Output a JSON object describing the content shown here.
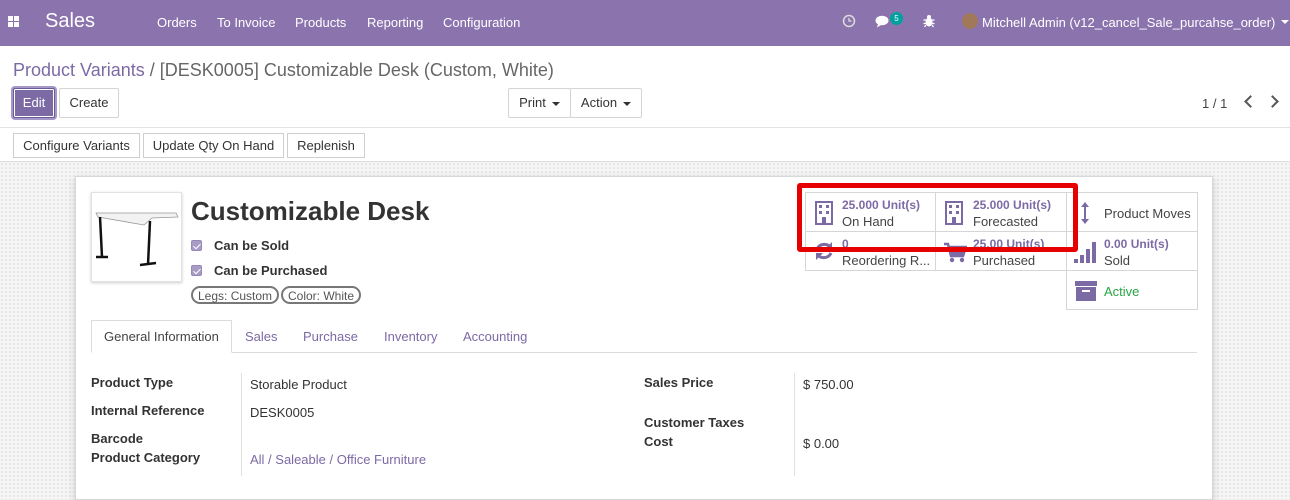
{
  "navbar": {
    "app_name": "Sales",
    "menu": [
      "Orders",
      "To Invoice",
      "Products",
      "Reporting",
      "Configuration"
    ],
    "messages_badge": "5",
    "user": "Mitchell Admin (v12_cancel_Sale_purcahse_order)",
    "bg_color": "#8b73ae"
  },
  "breadcrumb": {
    "parent": "Product Variants",
    "separator": "/",
    "current": "[DESK0005] Customizable Desk (Custom, White)"
  },
  "buttons": {
    "edit": "Edit",
    "create": "Create",
    "print": "Print",
    "action": "Action"
  },
  "pager": {
    "value": "1 / 1"
  },
  "statusbar": {
    "configure_variants": "Configure Variants",
    "update_qty": "Update Qty On Hand",
    "replenish": "Replenish"
  },
  "product": {
    "name": "Customizable Desk",
    "can_be_sold": "Can be Sold",
    "can_be_purchased": "Can be Purchased",
    "tags": [
      "Legs: Custom",
      "Color: White"
    ]
  },
  "smart_buttons": {
    "on_hand": {
      "value": "25.000",
      "unit": "Unit(s)",
      "label": "On Hand"
    },
    "forecasted": {
      "value": "25.000",
      "unit": "Unit(s)",
      "label": "Forecasted"
    },
    "product_moves": {
      "label": "Product Moves"
    },
    "reordering": {
      "value": "0",
      "label": "Reordering R..."
    },
    "purchased": {
      "value": "25.00",
      "unit": "Unit(s)",
      "label": "Purchased"
    },
    "sold": {
      "value": "0.00",
      "unit": "Unit(s)",
      "label": "Sold"
    },
    "active": {
      "label": "Active"
    }
  },
  "tabs": [
    "General Information",
    "Sales",
    "Purchase",
    "Inventory",
    "Accounting"
  ],
  "fields": {
    "product_type": {
      "label": "Product Type",
      "value": "Storable Product"
    },
    "internal_reference": {
      "label": "Internal Reference",
      "value": "DESK0005"
    },
    "barcode": {
      "label": "Barcode",
      "value": ""
    },
    "product_category": {
      "label": "Product Category",
      "value": "All / Saleable / Office Furniture"
    },
    "sales_price": {
      "label": "Sales Price",
      "value": "$ 750.00"
    },
    "customer_taxes": {
      "label": "Customer Taxes",
      "value": ""
    },
    "cost": {
      "label": "Cost",
      "value": "$ 0.00"
    }
  },
  "colors": {
    "accent": "#7c6aa5",
    "highlight": "#e60000",
    "active_green": "#28a745"
  }
}
